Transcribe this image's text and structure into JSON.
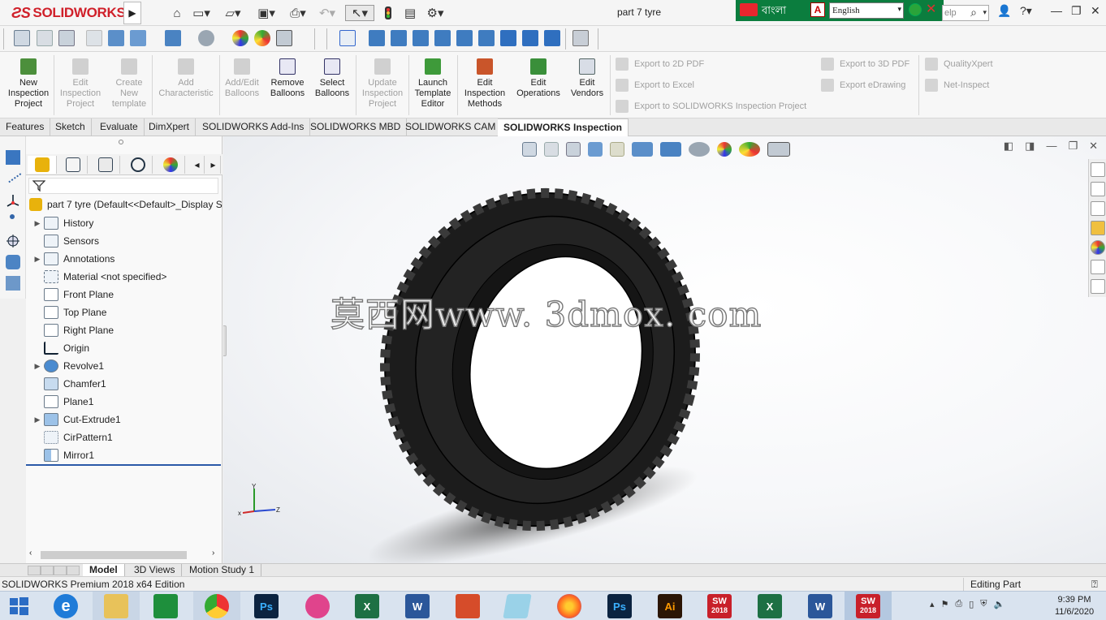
{
  "app": {
    "brand": "SOLIDWORKS",
    "document_title": "part 7 tyre",
    "language_banner": "বাংলা",
    "language_select": "English",
    "help_search_placeholder": "elp"
  },
  "ribbon": {
    "buttons": [
      {
        "label": "New\nInspection\nProject",
        "enabled": true
      },
      {
        "label": "Edit\nInspection\nProject",
        "enabled": false
      },
      {
        "label": "Create\nNew\ntemplate",
        "enabled": false
      },
      {
        "label": "Add\nCharacteristic",
        "enabled": false
      },
      {
        "label": "Add/Edit\nBalloons",
        "enabled": false
      },
      {
        "label": "Remove\nBalloons",
        "enabled": true
      },
      {
        "label": "Select\nBalloons",
        "enabled": true
      },
      {
        "label": "Update\nInspection\nProject",
        "enabled": false
      },
      {
        "label": "Launch\nTemplate\nEditor",
        "enabled": true
      },
      {
        "label": "Edit\nInspection\nMethods",
        "enabled": true
      },
      {
        "label": "Edit\nOperations",
        "enabled": true
      },
      {
        "label": "Edit\nVendors",
        "enabled": true
      }
    ],
    "exports": {
      "pdf2d": "Export to 2D PDF",
      "excel": "Export to Excel",
      "sw_project": "Export to SOLIDWORKS Inspection Project",
      "pdf3d": "Export to 3D PDF",
      "edrawing": "Export eDrawing",
      "qualityxpert": "QualityXpert",
      "netinspect": "Net-Inspect"
    }
  },
  "tabs": [
    "Features",
    "Sketch",
    "Evaluate",
    "DimXpert",
    "SOLIDWORKS Add-Ins",
    "SOLIDWORKS MBD",
    "SOLIDWORKS CAM",
    "SOLIDWORKS Inspection"
  ],
  "active_tab": "SOLIDWORKS Inspection",
  "feature_tree": {
    "root": "part 7 tyre  (Default<<Default>_Display S",
    "items": [
      {
        "label": "History",
        "expandable": true
      },
      {
        "label": "Sensors",
        "expandable": false
      },
      {
        "label": "Annotations",
        "expandable": true
      },
      {
        "label": "Material <not specified>",
        "expandable": false
      },
      {
        "label": "Front Plane",
        "expandable": false
      },
      {
        "label": "Top Plane",
        "expandable": false
      },
      {
        "label": "Right Plane",
        "expandable": false
      },
      {
        "label": "Origin",
        "expandable": false
      },
      {
        "label": "Revolve1",
        "expandable": true
      },
      {
        "label": "Chamfer1",
        "expandable": false
      },
      {
        "label": "Plane1",
        "expandable": false
      },
      {
        "label": "Cut-Extrude1",
        "expandable": true
      },
      {
        "label": "CirPattern1",
        "expandable": false
      },
      {
        "label": "Mirror1",
        "expandable": false
      }
    ]
  },
  "viewport": {
    "watermark": "莫西网www. 3dmox. com",
    "triad": {
      "x": "x",
      "y": "Y",
      "z": "Z"
    }
  },
  "model_tabs": [
    "Model",
    "3D Views",
    "Motion Study 1"
  ],
  "active_model_tab": "Model",
  "status": {
    "left": "SOLIDWORKS Premium 2018 x64 Edition",
    "right": "Editing Part"
  },
  "taskbar": {
    "apps": [
      "start",
      "internet-explorer",
      "file-explorer",
      "store",
      "chrome",
      "photoshop",
      "paint-app",
      "excel",
      "word",
      "outlook-app",
      "notes-app",
      "firefox",
      "photoshop-2",
      "illustrator",
      "solidworks-2018",
      "excel-2",
      "word-2",
      "solidworks-2018-active"
    ],
    "sw_version": "2018",
    "time": "9:39 PM",
    "date": "11/6/2020"
  },
  "colors": {
    "brand_red": "#d0202a",
    "lang_green": "#0b7d3e",
    "selection_blue": "#2b5aa8"
  }
}
